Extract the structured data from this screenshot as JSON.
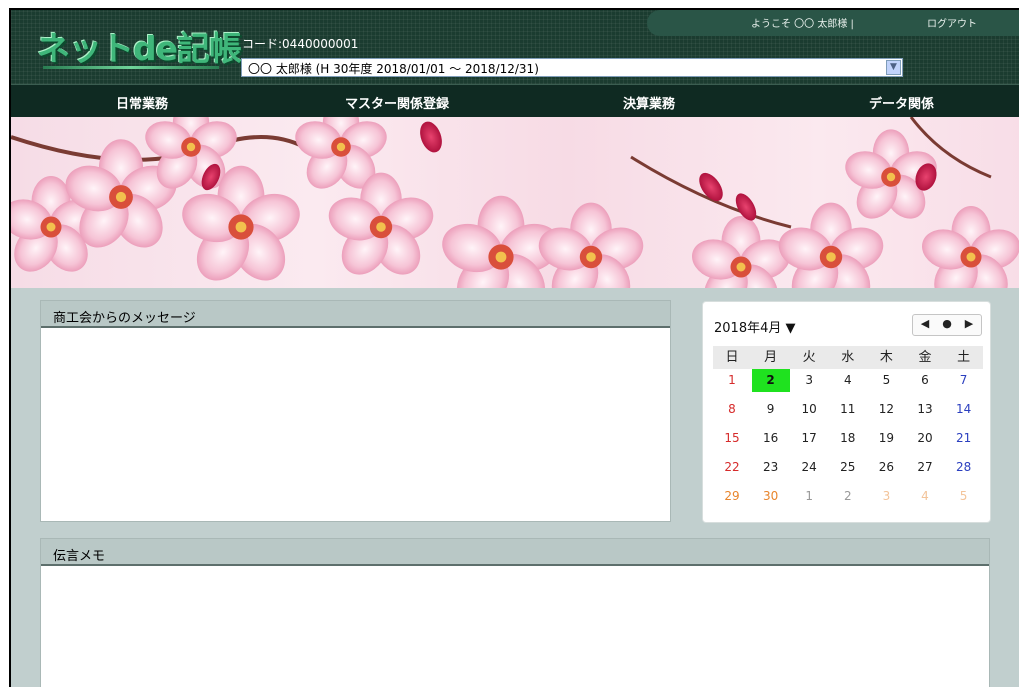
{
  "header": {
    "logo_text": "ネットde記帳",
    "code_label": "コード:0440000001",
    "fiscal_select_value": "〇〇 太郎様 (H 30年度 2018/01/01 ～ 2018/12/31)",
    "welcome": "ようこそ 〇〇 太郎様 |",
    "logout": "ログアウト"
  },
  "nav": {
    "items": [
      "日常業務",
      "マスター関係登録",
      "決算業務",
      "データ関係"
    ]
  },
  "message_panel": {
    "title": "商工会からのメッセージ"
  },
  "memo_panel": {
    "title": "伝言メモ"
  },
  "calendar": {
    "month_label": "2018年4月 ▼",
    "nav_prev": "◀",
    "nav_today": "●",
    "nav_next": "▶",
    "weekdays": [
      "日",
      "月",
      "火",
      "水",
      "木",
      "金",
      "土"
    ],
    "weeks": [
      [
        "1",
        "2",
        "3",
        "4",
        "5",
        "6",
        "7"
      ],
      [
        "8",
        "9",
        "10",
        "11",
        "12",
        "13",
        "14"
      ],
      [
        "15",
        "16",
        "17",
        "18",
        "19",
        "20",
        "21"
      ],
      [
        "22",
        "23",
        "24",
        "25",
        "26",
        "27",
        "28"
      ],
      [
        "29",
        "30",
        "1",
        "2",
        "3",
        "4",
        "5"
      ]
    ],
    "today": "2"
  },
  "colors": {
    "header_bg": "#1b3c30",
    "nav_bg": "#0f2a22",
    "page_bg": "#c1cfce",
    "today_highlight": "#1fe21f",
    "sunday": "#d62b2b",
    "saturday": "#2b3fbf",
    "holiday": "#e8852c"
  }
}
